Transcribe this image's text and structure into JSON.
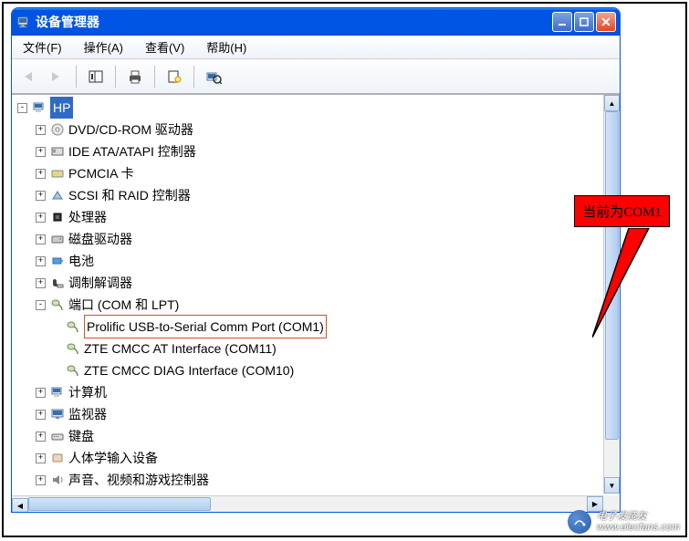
{
  "window": {
    "title": "设备管理器"
  },
  "menu": {
    "file": "文件(F)",
    "action": "操作(A)",
    "view": "查看(V)",
    "help": "帮助(H)"
  },
  "tree": {
    "root": "HP",
    "nodes": [
      "DVD/CD-ROM 驱动器",
      "IDE ATA/ATAPI 控制器",
      "PCMCIA 卡",
      "SCSI 和 RAID 控制器",
      "处理器",
      "磁盘驱动器",
      "电池",
      "调制解调器"
    ],
    "ports": {
      "label": "端口 (COM 和 LPT)",
      "children": [
        "Prolific USB-to-Serial Comm Port (COM1)",
        "ZTE CMCC AT Interface (COM11)",
        "ZTE CMCC DIAG Interface (COM10)"
      ]
    },
    "after": [
      "计算机",
      "监视器",
      "键盘",
      "人体学输入设备",
      "声音、视频和游戏控制器"
    ]
  },
  "callout": {
    "text": "当前为COM1"
  },
  "watermark": {
    "line1": "电子发烧友",
    "line2": "www.elecfans.com"
  }
}
